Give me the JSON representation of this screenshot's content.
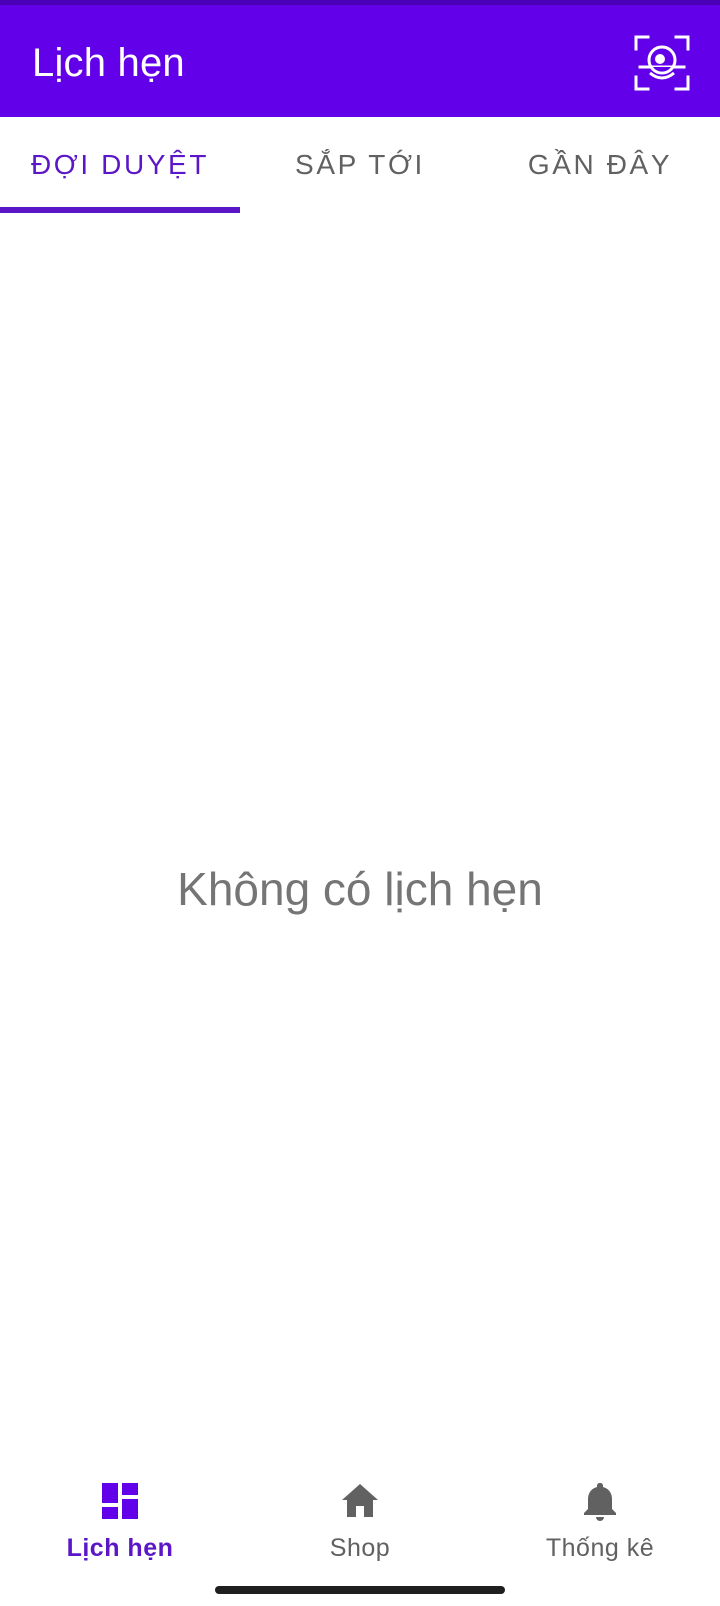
{
  "app_bar": {
    "title": "Lịch hẹn",
    "scan_icon": "face-scan-icon",
    "background": "#6200ea"
  },
  "tabs": [
    {
      "label": "ĐỢI DUYỆT",
      "active": true
    },
    {
      "label": "SẮP TỚI",
      "active": false
    },
    {
      "label": "GẦN ĐÂY",
      "active": false
    }
  ],
  "content": {
    "empty_message": "Không có lịch hẹn"
  },
  "bottom_nav": {
    "items": [
      {
        "label": "Lịch hẹn",
        "icon": "dashboard-icon",
        "active": true
      },
      {
        "label": "Shop",
        "icon": "home-icon",
        "active": false
      },
      {
        "label": "Thống kê",
        "icon": "bell-icon",
        "active": false
      }
    ]
  },
  "colors": {
    "primary": "#6200ea",
    "accent": "#5b16c8",
    "inactive": "#616161",
    "empty_text": "#757575"
  }
}
